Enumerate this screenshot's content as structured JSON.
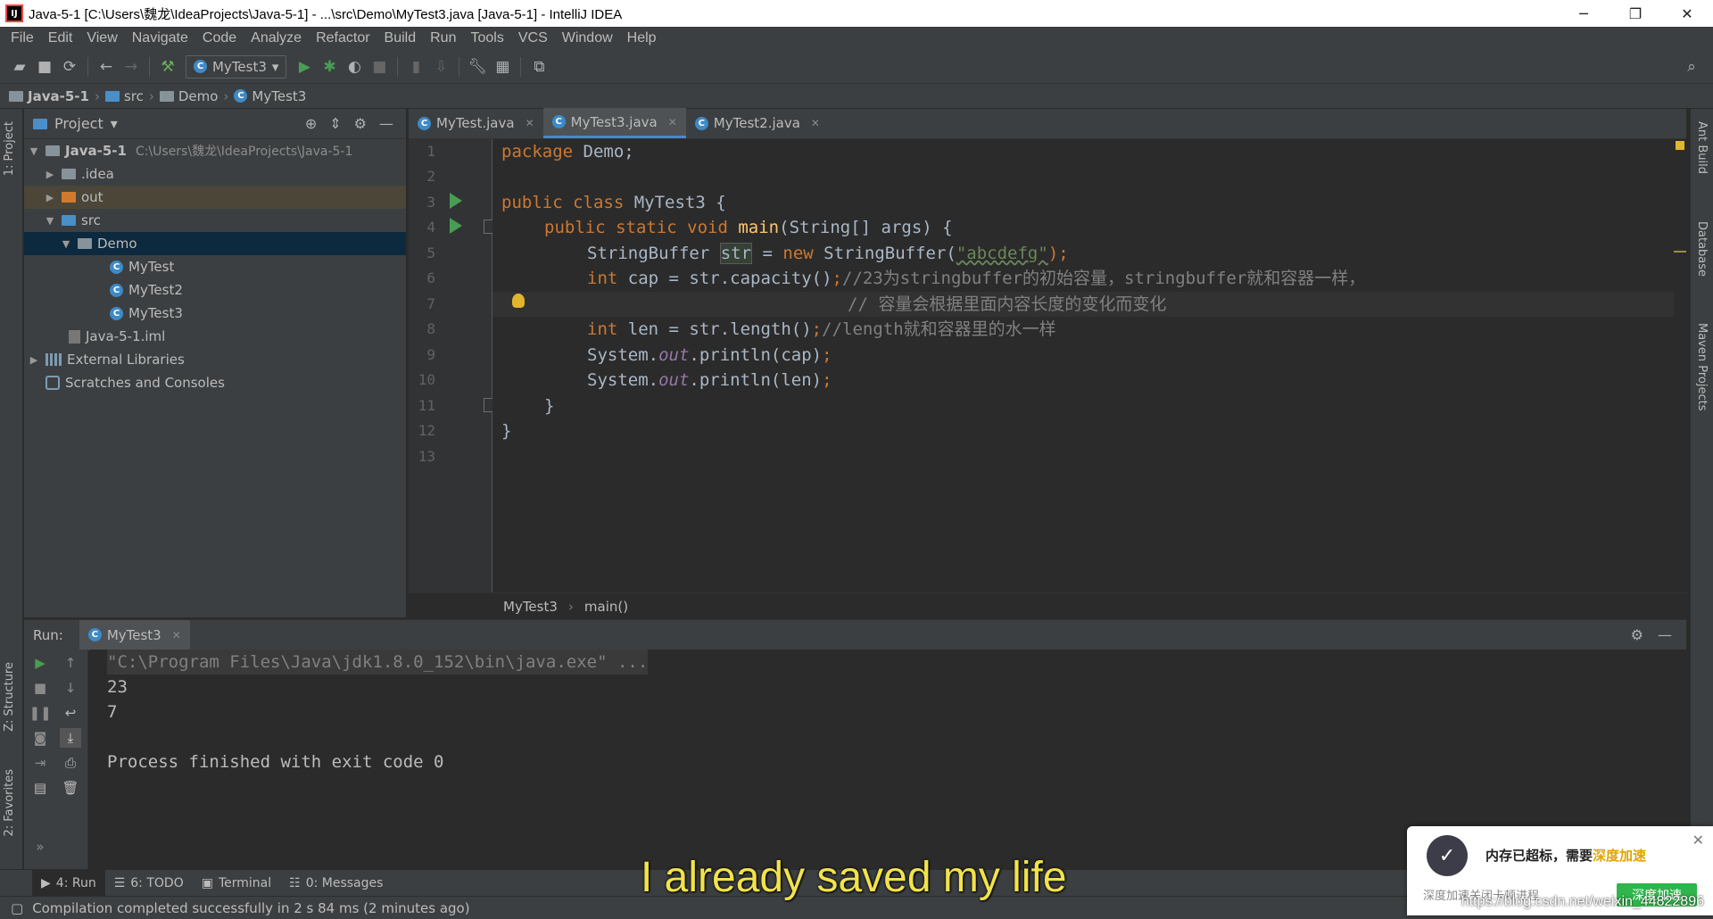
{
  "window": {
    "title": "Java-5-1 [C:\\Users\\魏龙\\IdeaProjects\\Java-5-1] - ...\\src\\Demo\\MyTest3.java [Java-5-1] - IntelliJ IDEA",
    "minimize": "─",
    "restore": "❐",
    "close": "✕"
  },
  "menu": [
    "File",
    "Edit",
    "View",
    "Navigate",
    "Code",
    "Analyze",
    "Refactor",
    "Build",
    "Run",
    "Tools",
    "VCS",
    "Window",
    "Help"
  ],
  "toolbar": {
    "run_config": "MyTest3"
  },
  "navbar": {
    "project": "Java-5-1",
    "src": "src",
    "package": "Demo",
    "class": "MyTest3"
  },
  "left_stripe": {
    "project_tab": "1: Project",
    "structure_tab": "Z: Structure",
    "favorites_tab": "2: Favorites"
  },
  "right_stripe": {
    "ant": "Ant Build",
    "database": "Database",
    "maven": "Maven Projects"
  },
  "project_panel": {
    "title": "Project",
    "tree": [
      {
        "label": "Java-5-1",
        "path": "C:\\Users\\魏龙\\IdeaProjects\\Java-5-1"
      },
      {
        "label": ".idea"
      },
      {
        "label": "out"
      },
      {
        "label": "src"
      },
      {
        "label": "Demo"
      },
      {
        "label": "MyTest"
      },
      {
        "label": "MyTest2"
      },
      {
        "label": "MyTest3"
      },
      {
        "label": "Java-5-1.iml"
      },
      {
        "label": "External Libraries"
      },
      {
        "label": "Scratches and Consoles"
      }
    ]
  },
  "editor": {
    "tabs": [
      "MyTest.java",
      "MyTest3.java",
      "MyTest2.java"
    ],
    "active_tab": "MyTest3.java",
    "line_numbers": [
      "1",
      "2",
      "3",
      "4",
      "5",
      "6",
      "7",
      "8",
      "9",
      "10",
      "11",
      "12",
      "13"
    ],
    "code": {
      "l1_kw": "package",
      "l1_rest": " Demo;",
      "l3_kw": "public class",
      "l3_rest": " MyTest3 {",
      "l4_kw": "public static void",
      "l4_fn": "main",
      "l4_rest": "(String[] args) {",
      "l5_a": "StringBuffer ",
      "l5_var": "str",
      "l5_b": " = ",
      "l5_kw": "new",
      "l5_c": " StringBuffer(",
      "l5_str": "\"abcdefg\"",
      "l5_d": ");",
      "l6_kw": "int",
      "l6_a": " cap = str.capacity()",
      "l6_semi": ";",
      "l6_cm": "//23为stringbuffer的初始容量，stringbuffer就和容器一样，",
      "l7_cm": "// 容量会根据里面内容长度的变化而变化",
      "l8_kw": "int",
      "l8_a": " len = str.length()",
      "l8_semi": ";",
      "l8_cm": "//length就和容器里的水一样",
      "l9_a": "System.",
      "l9_st": "out",
      "l9_b": ".println(cap)",
      "l9_semi": ";",
      "l10_a": "System.",
      "l10_st": "out",
      "l10_b": ".println(len)",
      "l10_semi": ";",
      "l11": "}",
      "l12": "}"
    },
    "breadcrumbs": [
      "MyTest3",
      "main()"
    ]
  },
  "run_panel": {
    "label": "Run:",
    "tab": "MyTest3",
    "console": [
      "\"C:\\Program Files\\Java\\jdk1.8.0_152\\bin\\java.exe\" ...",
      "23",
      "7",
      "",
      "Process finished with exit code 0"
    ]
  },
  "bottom_tabs": [
    "4: Run",
    "6: TODO",
    "Terminal",
    "0: Messages"
  ],
  "status": "Compilation completed successfully in 2 s 84 ms (2 minutes ago)",
  "subtitle": "I already saved my life",
  "popup": {
    "message": "内存已超标，需要",
    "accent": "深度加速",
    "sub": "深度加速关闭卡顿进程",
    "button": "深度加速",
    "accent_color": "#e2a400",
    "button_color": "#2fb54b"
  },
  "watermark": "https://blog.csdn.net/weixin_44822896"
}
